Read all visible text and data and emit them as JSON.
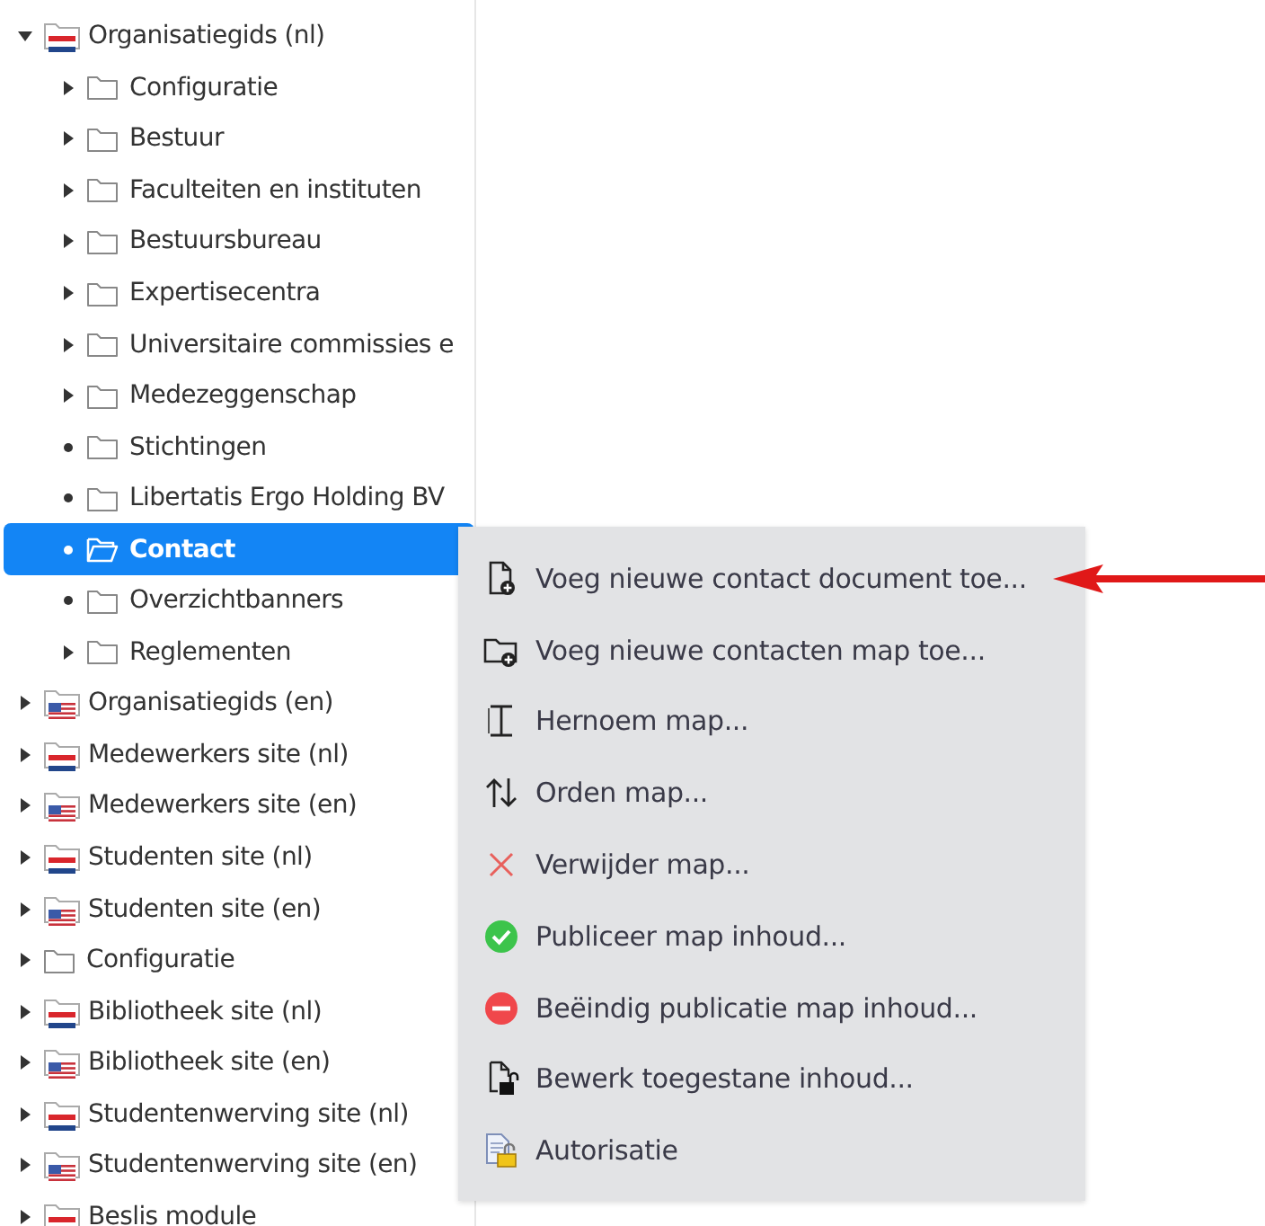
{
  "tree": [
    {
      "label": "Organisatiegids (nl)",
      "kind": "nl",
      "leaf": false,
      "expanded": true,
      "selected": false,
      "children": [
        {
          "label": "Configuratie",
          "kind": "folder",
          "leaf": false,
          "expanded": false,
          "selected": false
        },
        {
          "label": "Bestuur",
          "kind": "folder",
          "leaf": false,
          "expanded": false,
          "selected": false
        },
        {
          "label": "Faculteiten en instituten",
          "kind": "folder",
          "leaf": false,
          "expanded": false,
          "selected": false
        },
        {
          "label": "Bestuursbureau",
          "kind": "folder",
          "leaf": false,
          "expanded": false,
          "selected": false
        },
        {
          "label": "Expertisecentra",
          "kind": "folder",
          "leaf": false,
          "expanded": false,
          "selected": false
        },
        {
          "label": "Universitaire commissies e",
          "kind": "folder",
          "leaf": false,
          "expanded": false,
          "selected": false
        },
        {
          "label": "Medezeggenschap",
          "kind": "folder",
          "leaf": false,
          "expanded": false,
          "selected": false
        },
        {
          "label": "Stichtingen",
          "kind": "folder",
          "leaf": true,
          "selected": false
        },
        {
          "label": "Libertatis Ergo Holding BV",
          "kind": "folder",
          "leaf": true,
          "selected": false
        },
        {
          "label": "Contact",
          "kind": "folder",
          "leaf": true,
          "selected": true
        },
        {
          "label": "Overzichtbanners",
          "kind": "folder",
          "leaf": true,
          "selected": false
        },
        {
          "label": "Reglementen",
          "kind": "folder",
          "leaf": false,
          "expanded": false,
          "selected": false
        }
      ]
    },
    {
      "label": "Organisatiegids (en)",
      "kind": "en",
      "leaf": false,
      "expanded": false,
      "selected": false
    },
    {
      "label": "Medewerkers site (nl)",
      "kind": "nl",
      "leaf": false,
      "expanded": false,
      "selected": false
    },
    {
      "label": "Medewerkers site (en)",
      "kind": "en",
      "leaf": false,
      "expanded": false,
      "selected": false
    },
    {
      "label": "Studenten site (nl)",
      "kind": "nl",
      "leaf": false,
      "expanded": false,
      "selected": false
    },
    {
      "label": "Studenten site (en)",
      "kind": "en",
      "leaf": false,
      "expanded": false,
      "selected": false
    },
    {
      "label": "Configuratie",
      "kind": "folder",
      "leaf": false,
      "expanded": false,
      "selected": false
    },
    {
      "label": "Bibliotheek site (nl)",
      "kind": "nl",
      "leaf": false,
      "expanded": false,
      "selected": false
    },
    {
      "label": "Bibliotheek site (en)",
      "kind": "en",
      "leaf": false,
      "expanded": false,
      "selected": false
    },
    {
      "label": "Studentenwerving site (nl)",
      "kind": "nl",
      "leaf": false,
      "expanded": false,
      "selected": false
    },
    {
      "label": "Studentenwerving site (en)",
      "kind": "en",
      "leaf": false,
      "expanded": false,
      "selected": false
    },
    {
      "label": "Beslis module",
      "kind": "nl",
      "leaf": false,
      "expanded": false,
      "selected": false
    }
  ],
  "context_menu": {
    "items": [
      {
        "label": "Voeg nieuwe contact document toe..."
      },
      {
        "label": "Voeg nieuwe contacten map toe..."
      },
      {
        "label": "Hernoem map..."
      },
      {
        "label": "Orden map..."
      },
      {
        "label": "Verwijder map..."
      },
      {
        "label": "Publiceer map inhoud..."
      },
      {
        "label": "Beëindig publicatie map inhoud..."
      },
      {
        "label": "Bewerk toegestane inhoud..."
      },
      {
        "label": "Autorisatie"
      }
    ]
  }
}
